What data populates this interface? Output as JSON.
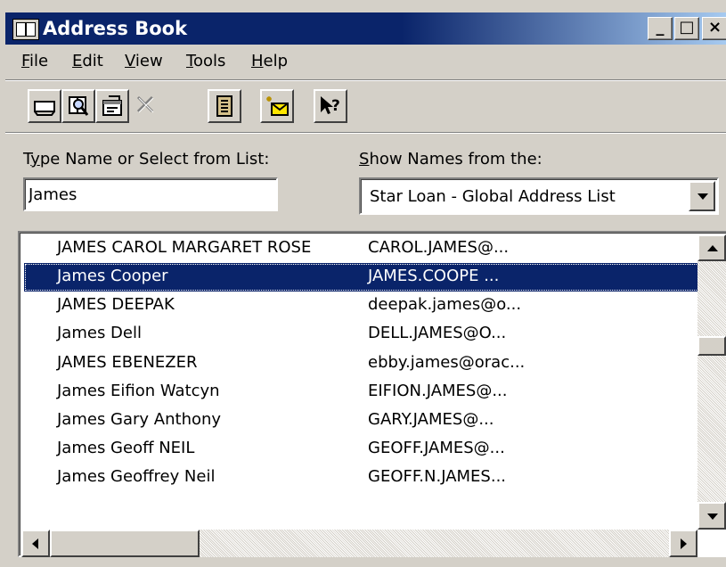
{
  "window": {
    "title": "Address Book",
    "minimize_glyph": "_",
    "maximize_glyph": "□",
    "close_glyph": "×"
  },
  "menu": [
    {
      "label": "File",
      "access_key": "F",
      "rest": "ile"
    },
    {
      "label": "Edit",
      "access_key": "E",
      "rest": "dit"
    },
    {
      "label": "View",
      "access_key": "V",
      "rest": "iew"
    },
    {
      "label": "Tools",
      "access_key": "T",
      "rest": "ools"
    },
    {
      "label": "Help",
      "access_key": "H",
      "rest": "elp"
    }
  ],
  "toolbar": {
    "icons": [
      "new-entry-icon",
      "find-icon",
      "properties-icon",
      "delete-icon",
      "address-book-icon",
      "new-message-icon",
      "whats-this-icon"
    ],
    "help_glyph": "?"
  },
  "search": {
    "label_prefix": "T",
    "label_access": "y",
    "label_rest": "pe Name or Select from List:",
    "value": "James"
  },
  "source": {
    "label_access": "S",
    "label_rest": "how Names from the:",
    "selected": "Star Loan - Global Address List"
  },
  "list": {
    "rows": [
      {
        "name": "JAMES CAROL MARGARET ROSE",
        "email": "CAROL.JAMES@...",
        "selected": false
      },
      {
        "name": "James Cooper",
        "email": "JAMES.COOPE ...",
        "selected": true
      },
      {
        "name": "JAMES DEEPAK",
        "email": "deepak.james@o...",
        "selected": false
      },
      {
        "name": "James Dell",
        "email": "DELL.JAMES@O...",
        "selected": false
      },
      {
        "name": "JAMES EBENEZER",
        "email": "ebby.james@orac...",
        "selected": false
      },
      {
        "name": "James Eifion Watcyn",
        "email": "EIFION.JAMES@...",
        "selected": false
      },
      {
        "name": "James Gary Anthony",
        "email": "GARY.JAMES@...",
        "selected": false
      },
      {
        "name": "James Geoff NEIL",
        "email": "GEOFF.JAMES@...",
        "selected": false
      },
      {
        "name": "James Geoffrey Neil",
        "email": "GEOFF.N.JAMES...",
        "selected": false
      }
    ]
  },
  "colors": {
    "face": "#d4d0c8",
    "title_active": "#0a246a",
    "title_gradient_end": "#a6caf0",
    "selection": "#0a246a",
    "list_background": "#ffffff"
  }
}
